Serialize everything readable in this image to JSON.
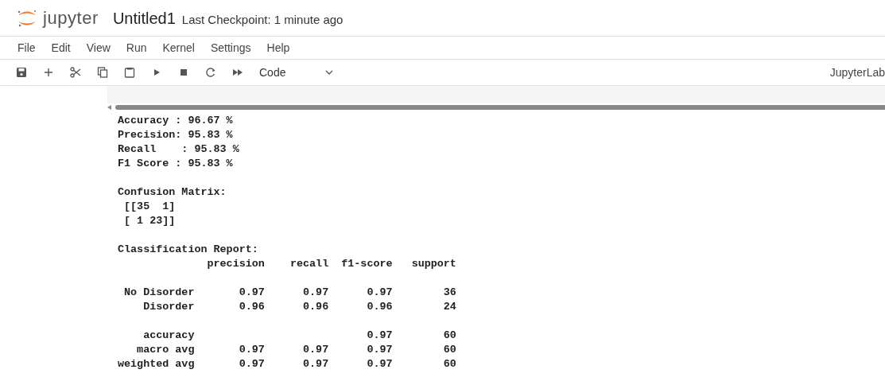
{
  "header": {
    "logo_text": "jupyter",
    "notebook_name": "Untitled1",
    "checkpoint": "Last Checkpoint: 1 minute ago"
  },
  "menu": [
    "File",
    "Edit",
    "View",
    "Run",
    "Kernel",
    "Settings",
    "Help"
  ],
  "toolbar": {
    "buttons": [
      {
        "kind": "save"
      },
      {
        "kind": "add"
      },
      {
        "kind": "cut"
      },
      {
        "kind": "copy"
      },
      {
        "kind": "paste"
      },
      {
        "kind": "run"
      },
      {
        "kind": "stop"
      },
      {
        "kind": "restart"
      },
      {
        "kind": "run-all"
      }
    ],
    "cell_type": "Code",
    "kernel": "JupyterLab"
  },
  "output_blocks": [
    [
      "Accuracy : 96.67 %",
      "Precision: 95.83 %",
      "Recall    : 95.83 %",
      "F1 Score : 95.83 %"
    ],
    [
      "Confusion Matrix:",
      " [[35  1]",
      " [ 1 23]]"
    ],
    [
      "Classification Report:",
      "              precision    recall  f1-score   support"
    ],
    [
      " No Disorder       0.97      0.97      0.97        36",
      "    Disorder       0.96      0.96      0.96        24"
    ],
    [
      "    accuracy                           0.97        60",
      "   macro avg       0.97      0.97      0.97        60",
      "weighted avg       0.97      0.97      0.97        60"
    ]
  ]
}
